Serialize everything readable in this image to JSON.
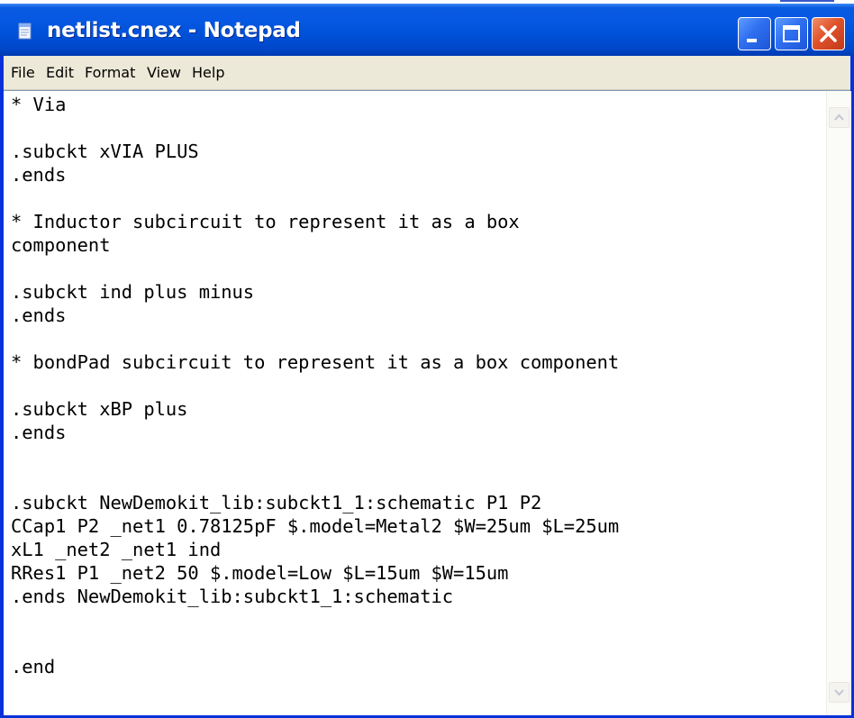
{
  "window": {
    "title": "netlist.cnex - Notepad"
  },
  "icons": {
    "app": "notepad-icon",
    "minimize": "minimize-icon",
    "maximize": "maximize-icon",
    "close": "close-icon",
    "scroll_up": "arrow-up-icon",
    "scroll_down": "arrow-down-icon"
  },
  "menu": {
    "file": "File",
    "edit": "Edit",
    "format": "Format",
    "view": "View",
    "help": "Help"
  },
  "document": {
    "content": "* Via\n\n.subckt xVIA PLUS\n.ends\n\n* Inductor subcircuit to represent it as a box\ncomponent\n\n.subckt ind plus minus\n.ends\n\n* bondPad subcircuit to represent it as a box component\n\n.subckt xBP plus\n.ends\n\n\n.subckt NewDemokit_lib:subckt1_1:schematic P1 P2\nCCap1 P2 _net1 0.78125pF $.model=Metal2 $W=25um $L=25um\nxL1 _net2 _net1 ind\nRRes1 P1 _net2 50 $.model=Low $L=15um $W=15um\n.ends NewDemokit_lib:subckt1_1:schematic\n\n\n.end"
  },
  "colors": {
    "titlebar": "#0758e3",
    "close_button": "#e0522a",
    "menubar": "#ece9d8"
  }
}
